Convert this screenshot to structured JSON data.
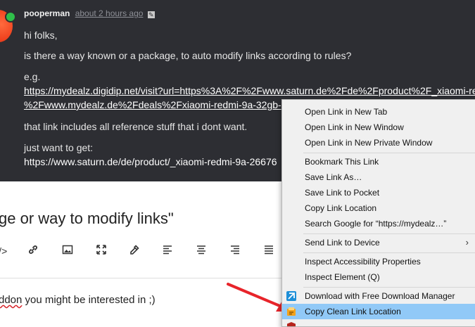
{
  "post": {
    "username": "pooperman",
    "time": "about 2 hours ago",
    "greeting": "hi folks,",
    "question": "is there a way known or a package, to auto modify links according to rules?",
    "eg": "e.g.",
    "link_line1": "https://mydealz.digidip.net/visit?url=https%3A%2F%2Fwww.saturn.de%2Fde%2Fproduct%2F_xiaomi-re",
    "link_line2": "%2Fwww.mydealz.de%2Fdeals%2Fxiaomi-redmi-9a-32gb-",
    "note": "that link includes all reference stuff that i dont want.",
    "want": "just want to get:",
    "clean_url": "https://www.saturn.de/de/product/_xiaomi-redmi-9a-26676"
  },
  "reply": {
    "title": "ge or way to modify links\"",
    "text_prefix": "ddon",
    "text_rest": " you might be interested in ;)"
  },
  "toolbar": {
    "code": "</>",
    "link_icon": "link-icon",
    "image_icon": "image-icon",
    "fullscreen_icon": "fullscreen-icon",
    "eyedropper_icon": "eyedropper-icon",
    "align_left_icon": "align-left-icon",
    "align_center_icon": "align-center-icon",
    "align_right_icon": "align-right-icon",
    "align_justify_icon": "align-justify-icon"
  },
  "context_menu": {
    "open_new_tab": "Open Link in New Tab",
    "open_new_window": "Open Link in New Window",
    "open_private_window": "Open Link in New Private Window",
    "bookmark": "Bookmark This Link",
    "save_link": "Save Link As…",
    "save_pocket": "Save Link to Pocket",
    "copy_location": "Copy Link Location",
    "search_google": "Search Google for “https://mydealz…”",
    "send_device": "Send Link to Device",
    "inspect_accessibility": "Inspect Accessibility Properties",
    "inspect_element": "Inspect Element (Q)",
    "download_fdm": "Download with Free Download Manager",
    "copy_clean": "Copy Clean Link Location",
    "highlight_color": "#91c9f7"
  },
  "colors": {
    "post_bg": "#2d2e33",
    "arrow": "#e8242a",
    "online": "#2fbf4a"
  }
}
